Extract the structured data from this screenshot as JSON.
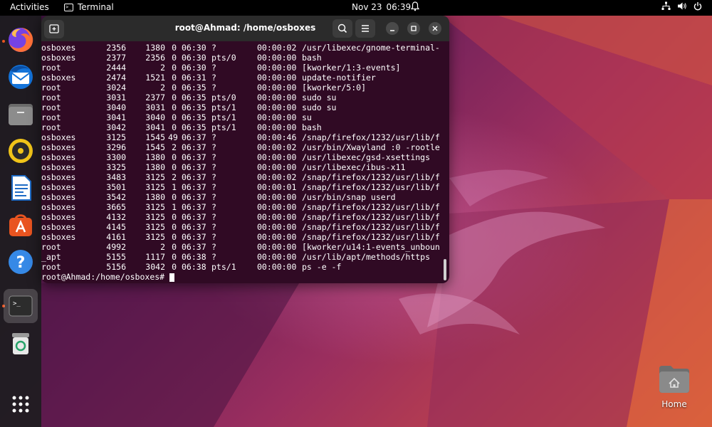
{
  "topbar": {
    "activities": "Activities",
    "app_name": "Terminal",
    "date": "Nov 23",
    "time": "06:39"
  },
  "dock": {
    "items": [
      {
        "name": "firefox-icon",
        "running": true
      },
      {
        "name": "thunderbird-icon",
        "running": false
      },
      {
        "name": "files-icon",
        "running": false
      },
      {
        "name": "rhythmbox-icon",
        "running": false
      },
      {
        "name": "libreoffice-writer-icon",
        "running": false
      },
      {
        "name": "software-center-icon",
        "running": false
      },
      {
        "name": "help-icon",
        "running": false
      },
      {
        "name": "terminal-icon",
        "running": true
      },
      {
        "name": "trash-icon",
        "running": false
      }
    ],
    "show_apps": "show-apps-icon"
  },
  "terminal": {
    "title": "root@Ahmad: /home/osboxes",
    "rows": [
      {
        "uid": "osboxes",
        "pid": "2356",
        "ppid": "1380",
        "c": "0",
        "stime": "06:30",
        "tty": "?",
        "time": "00:00:02",
        "cmd": "/usr/libexec/gnome-terminal-"
      },
      {
        "uid": "osboxes",
        "pid": "2377",
        "ppid": "2356",
        "c": "0",
        "stime": "06:30",
        "tty": "pts/0",
        "time": "00:00:00",
        "cmd": "bash"
      },
      {
        "uid": "root",
        "pid": "2444",
        "ppid": "2",
        "c": "0",
        "stime": "06:30",
        "tty": "?",
        "time": "00:00:00",
        "cmd": "[kworker/1:3-events]"
      },
      {
        "uid": "osboxes",
        "pid": "2474",
        "ppid": "1521",
        "c": "0",
        "stime": "06:31",
        "tty": "?",
        "time": "00:00:00",
        "cmd": "update-notifier"
      },
      {
        "uid": "root",
        "pid": "3024",
        "ppid": "2",
        "c": "0",
        "stime": "06:35",
        "tty": "?",
        "time": "00:00:00",
        "cmd": "[kworker/5:0]"
      },
      {
        "uid": "root",
        "pid": "3031",
        "ppid": "2377",
        "c": "0",
        "stime": "06:35",
        "tty": "pts/0",
        "time": "00:00:00",
        "cmd": "sudo su"
      },
      {
        "uid": "root",
        "pid": "3040",
        "ppid": "3031",
        "c": "0",
        "stime": "06:35",
        "tty": "pts/1",
        "time": "00:00:00",
        "cmd": "sudo su"
      },
      {
        "uid": "root",
        "pid": "3041",
        "ppid": "3040",
        "c": "0",
        "stime": "06:35",
        "tty": "pts/1",
        "time": "00:00:00",
        "cmd": "su"
      },
      {
        "uid": "root",
        "pid": "3042",
        "ppid": "3041",
        "c": "0",
        "stime": "06:35",
        "tty": "pts/1",
        "time": "00:00:00",
        "cmd": "bash"
      },
      {
        "uid": "osboxes",
        "pid": "3125",
        "ppid": "1545",
        "c": "49",
        "stime": "06:37",
        "tty": "?",
        "time": "00:00:46",
        "cmd": "/snap/firefox/1232/usr/lib/f"
      },
      {
        "uid": "osboxes",
        "pid": "3296",
        "ppid": "1545",
        "c": "2",
        "stime": "06:37",
        "tty": "?",
        "time": "00:00:02",
        "cmd": "/usr/bin/Xwayland :0 -rootle"
      },
      {
        "uid": "osboxes",
        "pid": "3300",
        "ppid": "1380",
        "c": "0",
        "stime": "06:37",
        "tty": "?",
        "time": "00:00:00",
        "cmd": "/usr/libexec/gsd-xsettings"
      },
      {
        "uid": "osboxes",
        "pid": "3325",
        "ppid": "1380",
        "c": "0",
        "stime": "06:37",
        "tty": "?",
        "time": "00:00:00",
        "cmd": "/usr/libexec/ibus-x11"
      },
      {
        "uid": "osboxes",
        "pid": "3483",
        "ppid": "3125",
        "c": "2",
        "stime": "06:37",
        "tty": "?",
        "time": "00:00:02",
        "cmd": "/snap/firefox/1232/usr/lib/f"
      },
      {
        "uid": "osboxes",
        "pid": "3501",
        "ppid": "3125",
        "c": "1",
        "stime": "06:37",
        "tty": "?",
        "time": "00:00:01",
        "cmd": "/snap/firefox/1232/usr/lib/f"
      },
      {
        "uid": "osboxes",
        "pid": "3542",
        "ppid": "1380",
        "c": "0",
        "stime": "06:37",
        "tty": "?",
        "time": "00:00:00",
        "cmd": "/usr/bin/snap userd"
      },
      {
        "uid": "osboxes",
        "pid": "3665",
        "ppid": "3125",
        "c": "1",
        "stime": "06:37",
        "tty": "?",
        "time": "00:00:00",
        "cmd": "/snap/firefox/1232/usr/lib/f"
      },
      {
        "uid": "osboxes",
        "pid": "4132",
        "ppid": "3125",
        "c": "0",
        "stime": "06:37",
        "tty": "?",
        "time": "00:00:00",
        "cmd": "/snap/firefox/1232/usr/lib/f"
      },
      {
        "uid": "osboxes",
        "pid": "4145",
        "ppid": "3125",
        "c": "0",
        "stime": "06:37",
        "tty": "?",
        "time": "00:00:00",
        "cmd": "/snap/firefox/1232/usr/lib/f"
      },
      {
        "uid": "osboxes",
        "pid": "4161",
        "ppid": "3125",
        "c": "0",
        "stime": "06:37",
        "tty": "?",
        "time": "00:00:00",
        "cmd": "/snap/firefox/1232/usr/lib/f"
      },
      {
        "uid": "root",
        "pid": "4992",
        "ppid": "2",
        "c": "0",
        "stime": "06:37",
        "tty": "?",
        "time": "00:00:00",
        "cmd": "[kworker/u14:1-events_unboun"
      },
      {
        "uid": "_apt",
        "pid": "5155",
        "ppid": "1117",
        "c": "0",
        "stime": "06:38",
        "tty": "?",
        "time": "00:00:00",
        "cmd": "/usr/lib/apt/methods/https"
      },
      {
        "uid": "root",
        "pid": "5156",
        "ppid": "3042",
        "c": "0",
        "stime": "06:38",
        "tty": "pts/1",
        "time": "00:00:00",
        "cmd": "ps -e -f"
      }
    ],
    "prompt": "root@Ahmad:/home/osboxes#"
  },
  "desktop": {
    "home_label": "Home"
  },
  "colors": {
    "terminal_bg": "#300a24",
    "titlebar_bg": "#2b2b2b",
    "accent": "#e95420"
  }
}
